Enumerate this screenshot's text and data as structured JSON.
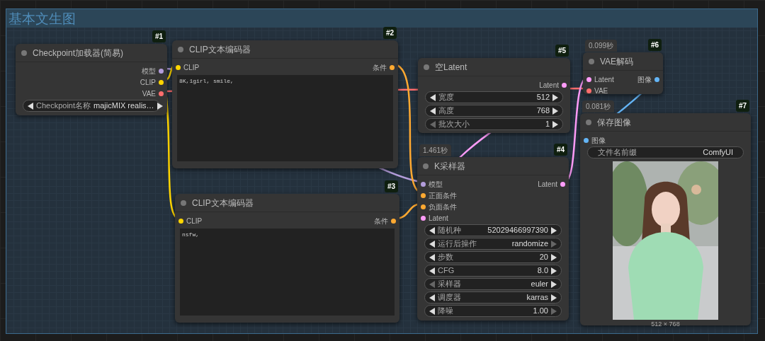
{
  "group": {
    "title": "基本文生图"
  },
  "nodes": [
    {
      "badge": "#1",
      "title": "Checkpoint加载器(简易)",
      "outputs": [
        {
          "label": "模型",
          "color": "#b39ddb"
        },
        {
          "label": "CLIP",
          "color": "#ffd500"
        },
        {
          "label": "VAE",
          "color": "#ff6e6e"
        }
      ],
      "widgets": [
        {
          "kind": "combo",
          "label": "Checkpoint名称",
          "value": "majicMIX realis…",
          "prev_disabled": false,
          "next_disabled": false
        }
      ]
    },
    {
      "badge": "#2",
      "title": "CLIP文本编码器",
      "inputs": [
        {
          "label": "CLIP",
          "color": "#ffd500"
        }
      ],
      "outputs": [
        {
          "label": "条件",
          "color": "#ffa931"
        }
      ],
      "widgets": [
        {
          "kind": "textarea",
          "value": "8K,1girl, smile,"
        }
      ]
    },
    {
      "badge": "#3",
      "title": "CLIP文本编码器",
      "inputs": [
        {
          "label": "CLIP",
          "color": "#ffd500"
        }
      ],
      "outputs": [
        {
          "label": "条件",
          "color": "#ffa931"
        }
      ],
      "widgets": [
        {
          "kind": "textarea",
          "value": "nsfw,"
        }
      ]
    },
    {
      "badge": "#5",
      "title": "空Latent",
      "outputs": [
        {
          "label": "Latent",
          "color": "#ff9cf9"
        }
      ],
      "widgets": [
        {
          "kind": "combo",
          "label": "宽度",
          "value": "512",
          "prev_disabled": false,
          "next_disabled": false
        },
        {
          "kind": "combo",
          "label": "高度",
          "value": "768",
          "prev_disabled": false,
          "next_disabled": false
        },
        {
          "kind": "combo",
          "label": "批次大小",
          "value": "1",
          "prev_disabled": true,
          "next_disabled": false
        }
      ]
    },
    {
      "badge": "#6",
      "timing": "0.099秒",
      "title": "VAE解码",
      "inputs": [
        {
          "label": "Latent",
          "color": "#ff9cf9"
        },
        {
          "label": "VAE",
          "color": "#ff6e6e"
        }
      ],
      "outputs": [
        {
          "label": "图像",
          "color": "#64b5f6"
        }
      ]
    },
    {
      "badge": "#4",
      "timing": "1.461秒",
      "title": "K采样器",
      "inputs": [
        {
          "label": "模型",
          "color": "#b39ddb"
        },
        {
          "label": "正面条件",
          "color": "#ffa931"
        },
        {
          "label": "负面条件",
          "color": "#ffa931"
        },
        {
          "label": "Latent",
          "color": "#ff9cf9"
        }
      ],
      "outputs": [
        {
          "label": "Latent",
          "color": "#ff9cf9"
        }
      ],
      "widgets": [
        {
          "kind": "combo",
          "label": "随机种",
          "value": "52029466997390",
          "prev_disabled": false,
          "next_disabled": false
        },
        {
          "kind": "combo",
          "label": "运行后操作",
          "value": "randomize",
          "prev_disabled": false,
          "next_disabled": true
        },
        {
          "kind": "combo",
          "label": "步数",
          "value": "20",
          "prev_disabled": false,
          "next_disabled": false
        },
        {
          "kind": "combo",
          "label": "CFG",
          "value": "8.0",
          "prev_disabled": false,
          "next_disabled": false
        },
        {
          "kind": "combo",
          "label": "采样器",
          "value": "euler",
          "prev_disabled": true,
          "next_disabled": false
        },
        {
          "kind": "combo",
          "label": "调度器",
          "value": "karras",
          "prev_disabled": false,
          "next_disabled": false
        },
        {
          "kind": "combo",
          "label": "降噪",
          "value": "1.00",
          "prev_disabled": false,
          "next_disabled": true
        }
      ]
    },
    {
      "badge": "#7",
      "timing": "0.081秒",
      "title": "保存图像",
      "inputs": [
        {
          "label": "图像",
          "color": "#64b5f6"
        }
      ],
      "widgets": [
        {
          "kind": "text",
          "label": "文件名前缀",
          "value": "ComfyUI"
        },
        {
          "caption": "512 × 768"
        }
      ]
    }
  ]
}
